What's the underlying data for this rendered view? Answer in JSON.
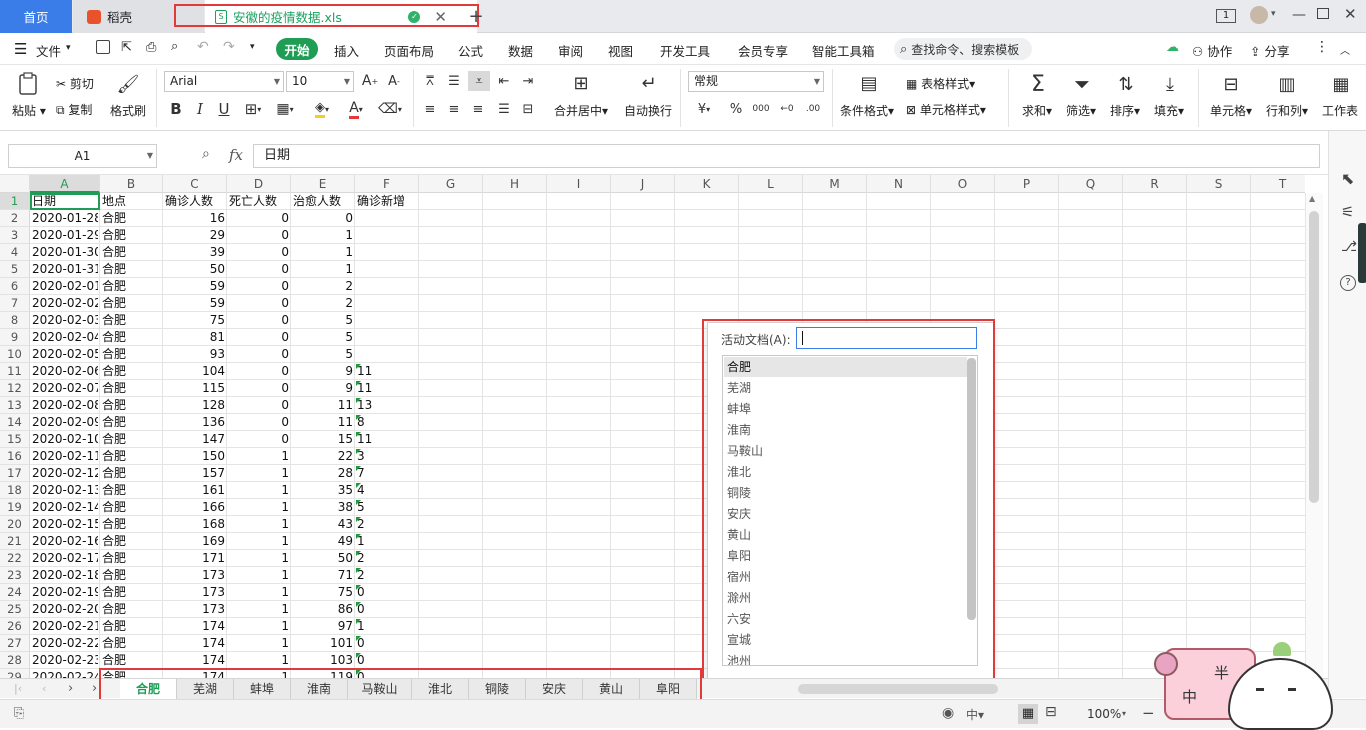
{
  "titlebar": {
    "home_tab": "首页",
    "daoke_tab": "稻壳",
    "file_tab": "安徽的疫情数据.xls",
    "page_indicator": "1"
  },
  "menubar": {
    "file_menu": "文件",
    "items": [
      "开始",
      "插入",
      "页面布局",
      "公式",
      "数据",
      "审阅",
      "视图",
      "开发工具",
      "会员专享",
      "智能工具箱"
    ],
    "search_placeholder": "查找命令、搜索模板",
    "collaborate": "协作",
    "share": "分享"
  },
  "ribbon": {
    "paste": "粘贴",
    "cut": "剪切",
    "copy": "复制",
    "format_painter": "格式刷",
    "font_name": "Arial",
    "font_size": "10",
    "merge_center": "合并居中",
    "wrap_text": "自动换行",
    "number_format": "常规",
    "conditional_format": "条件格式",
    "table_style": "表格样式",
    "cell_style": "单元格样式",
    "sum": "求和",
    "filter": "筛选",
    "sort": "排序",
    "fill": "填充",
    "cells": "单元格",
    "rows_cols": "行和列",
    "worksheet": "工作表"
  },
  "formula_bar": {
    "name_box": "A1",
    "fx_label": "fx",
    "content": "日期"
  },
  "columns": [
    "A",
    "B",
    "C",
    "D",
    "E",
    "F",
    "G",
    "H",
    "I",
    "J",
    "K",
    "L",
    "M",
    "N",
    "O",
    "P",
    "Q",
    "R",
    "S",
    "T"
  ],
  "header_row": [
    "日期",
    "地点",
    "确诊人数",
    "死亡人数",
    "治愈人数",
    "确诊新增"
  ],
  "rows": [
    [
      "2020-01-28",
      "合肥",
      "16",
      "0",
      "0",
      ""
    ],
    [
      "2020-01-29",
      "合肥",
      "29",
      "0",
      "1",
      ""
    ],
    [
      "2020-01-30",
      "合肥",
      "39",
      "0",
      "1",
      ""
    ],
    [
      "2020-01-31",
      "合肥",
      "50",
      "0",
      "1",
      ""
    ],
    [
      "2020-02-01",
      "合肥",
      "59",
      "0",
      "2",
      ""
    ],
    [
      "2020-02-02",
      "合肥",
      "59",
      "0",
      "2",
      ""
    ],
    [
      "2020-02-03",
      "合肥",
      "75",
      "0",
      "5",
      ""
    ],
    [
      "2020-02-04",
      "合肥",
      "81",
      "0",
      "5",
      ""
    ],
    [
      "2020-02-05",
      "合肥",
      "93",
      "0",
      "5",
      ""
    ],
    [
      "2020-02-06",
      "合肥",
      "104",
      "0",
      "9",
      "11"
    ],
    [
      "2020-02-07",
      "合肥",
      "115",
      "0",
      "9",
      "11"
    ],
    [
      "2020-02-08",
      "合肥",
      "128",
      "0",
      "11",
      "13"
    ],
    [
      "2020-02-09",
      "合肥",
      "136",
      "0",
      "11",
      "8"
    ],
    [
      "2020-02-10",
      "合肥",
      "147",
      "0",
      "15",
      "11"
    ],
    [
      "2020-02-11",
      "合肥",
      "150",
      "1",
      "22",
      "3"
    ],
    [
      "2020-02-12",
      "合肥",
      "157",
      "1",
      "28",
      "7"
    ],
    [
      "2020-02-13",
      "合肥",
      "161",
      "1",
      "35",
      "4"
    ],
    [
      "2020-02-14",
      "合肥",
      "166",
      "1",
      "38",
      "5"
    ],
    [
      "2020-02-15",
      "合肥",
      "168",
      "1",
      "43",
      "2"
    ],
    [
      "2020-02-16",
      "合肥",
      "169",
      "1",
      "49",
      "1"
    ],
    [
      "2020-02-17",
      "合肥",
      "171",
      "1",
      "50",
      "2"
    ],
    [
      "2020-02-18",
      "合肥",
      "173",
      "1",
      "71",
      "2"
    ],
    [
      "2020-02-19",
      "合肥",
      "173",
      "1",
      "75",
      "0"
    ],
    [
      "2020-02-20",
      "合肥",
      "173",
      "1",
      "86",
      "0"
    ],
    [
      "2020-02-21",
      "合肥",
      "174",
      "1",
      "97",
      "1"
    ],
    [
      "2020-02-22",
      "合肥",
      "174",
      "1",
      "101",
      "0"
    ],
    [
      "2020-02-23",
      "合肥",
      "174",
      "1",
      "103",
      "0"
    ],
    [
      "2020-02-24",
      "合肥",
      "174",
      "1",
      "119",
      "0"
    ]
  ],
  "activate_dialog": {
    "label": "活动文档(A):",
    "input_value": "",
    "items": [
      "合肥",
      "芜湖",
      "蚌埠",
      "淮南",
      "马鞍山",
      "淮北",
      "铜陵",
      "安庆",
      "黄山",
      "阜阳",
      "宿州",
      "滁州",
      "六安",
      "宣城",
      "池州"
    ],
    "selected": "合肥"
  },
  "sheet_tabs": [
    "合肥",
    "芜湖",
    "蚌埠",
    "淮南",
    "马鞍山",
    "淮北",
    "铜陵",
    "安庆",
    "黄山",
    "阜阳"
  ],
  "active_sheet": "合肥",
  "statusbar": {
    "zoom": "100%"
  },
  "sticker_text": [
    "半",
    "中"
  ],
  "colors": {
    "accent_green": "#1f9d55",
    "home_tab_blue": "#3b7de8",
    "highlight_red": "#e03a3a"
  }
}
